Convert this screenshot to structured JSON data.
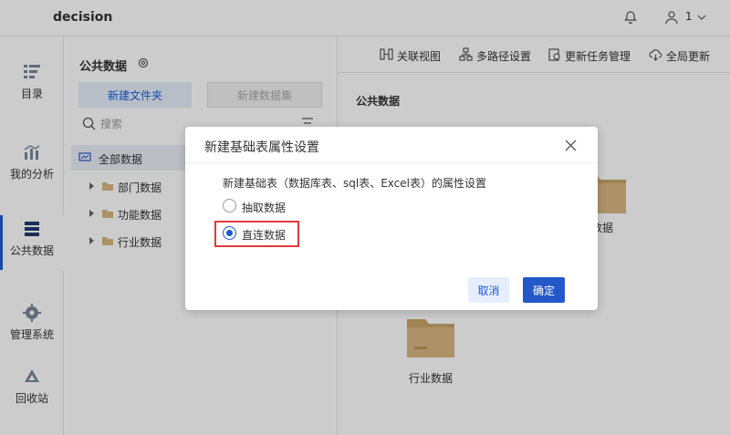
{
  "app": {
    "title": "decision",
    "user_count": "1"
  },
  "rail": {
    "items": [
      {
        "label": "目录"
      },
      {
        "label": "我的分析"
      },
      {
        "label": "公共数据"
      },
      {
        "label": "管理系统"
      },
      {
        "label": "回收站"
      }
    ]
  },
  "panel": {
    "title": "公共数据",
    "new_folder_label": "新建文件夹",
    "new_dataset_label": "新建数据集",
    "search_placeholder": "搜索",
    "tree": {
      "root": "全部数据",
      "nodes": [
        "部门数据",
        "功能数据",
        "行业数据"
      ]
    }
  },
  "toolbar": {
    "items": [
      "关联视图",
      "多路径设置",
      "更新任务管理",
      "全局更新"
    ]
  },
  "content": {
    "title": "公共数据",
    "folders": [
      "数据",
      "行业数据"
    ]
  },
  "dialog": {
    "title": "新建基础表属性设置",
    "description": "新建基础表（数据库表、sql表、Excel表）的属性设置",
    "options": [
      "抽取数据",
      "直连数据"
    ],
    "selected": "直连数据",
    "cancel_label": "取消",
    "ok_label": "确定"
  },
  "colors": {
    "accent": "#2458c9",
    "highlight": "#e03b3b",
    "folder": "#d9b783"
  }
}
